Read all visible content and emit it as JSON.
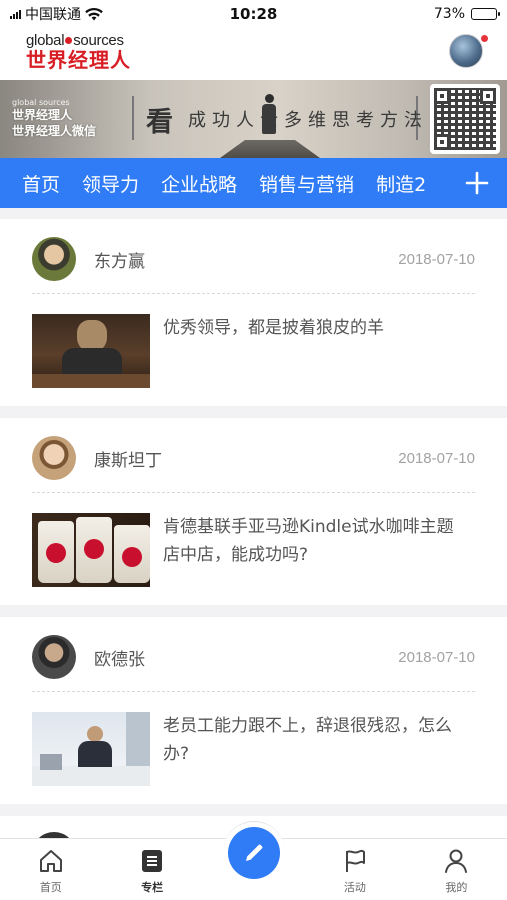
{
  "status_bar": {
    "carrier": "中国联通",
    "time": "10:28",
    "battery": "73%",
    "battery_level": 0.73
  },
  "header": {
    "logo_en_left": "global",
    "logo_en_right": "sources",
    "logo_cn": "世界经理人"
  },
  "banner": {
    "brand_small": "global sources",
    "brand_line1": "世界经理人",
    "brand_line2": "世界经理人微信",
    "big_char": "看",
    "slogan": "成功人士多维思考方法"
  },
  "nav": {
    "tabs": [
      "首页",
      "领导力",
      "企业战略",
      "销售与营销",
      "制造2"
    ]
  },
  "feed": {
    "cards": [
      {
        "author": "东方赢",
        "date": "2018-07-10",
        "title": "优秀领导，都是披着狼皮的羊"
      },
      {
        "author": "康斯坦丁",
        "date": "2018-07-10",
        "title": "肯德基联手亚马逊Kindle试水咖啡主题店中店，能成功吗?"
      },
      {
        "author": "欧德张",
        "date": "2018-07-10",
        "title": "老员工能力跟不上，辞退很残忍，怎么办?"
      }
    ]
  },
  "tab_bar": {
    "items": [
      {
        "label": "首页",
        "icon": "home-icon"
      },
      {
        "label": "专栏",
        "icon": "column-icon"
      },
      {
        "label": "",
        "icon": "pencil-icon"
      },
      {
        "label": "活动",
        "icon": "flag-icon"
      },
      {
        "label": "我的",
        "icon": "person-icon"
      }
    ]
  },
  "colors": {
    "accent": "#2f7cf6",
    "brand_red": "#d81e25"
  }
}
